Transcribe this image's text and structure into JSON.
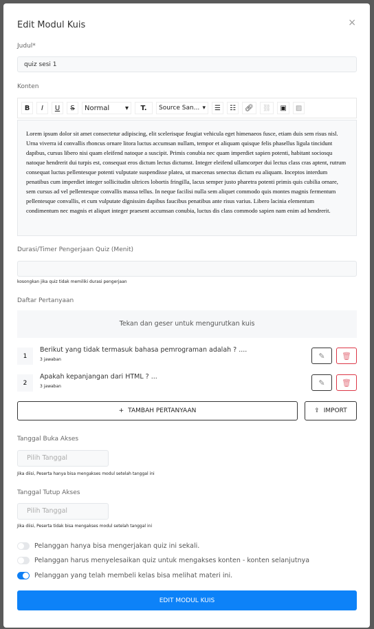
{
  "modal": {
    "title": "Edit Modul Kuis",
    "close": "×"
  },
  "judul": {
    "label": "Judul*",
    "value": "quiz sesi 1"
  },
  "konten": {
    "label": "Konten",
    "toolbar": {
      "bold": "B",
      "italic": "I",
      "underline": "U",
      "strike": "S",
      "format": "Normal",
      "size": "T.",
      "font": "Source San...",
      "dropdown": "▾"
    },
    "text": "Lorem ipsum dolor sit amet consectetur adipiscing, elit scelerisque feugiat vehicula eget himenaeos fusce, etiam duis sem risus nisl. Urna viverra id convallis rhoncus ornare litora luctus accumsan nullam, tempor et aliquam quisque felis phasellus ligula tincidunt dapibus, cursus libero nisi quam eleifend natoque a suscipit. Primis conubia nec quam imperdiet sapien potenti, habitant sociosqu natoque hendrerit dui turpis est, consequat eros dictum lectus dictumst. Integer eleifend ullamcorper dui lectus class cras aptent, rutrum consequat luctus pellentesque potenti vulputate suspendisse platea, ut maecenas senectus dictum eu aliquam. Inceptos interdum penatibus cum imperdiet integer sollicitudin ultrices lobortis fringilla, lacus semper justo pharetra potenti primis quis cubilia ornare, sem cursus ad vel pellentesque convallis massa tellus. In neque facilisi nulla sem aliquet commodo quis montes magnis fermentum pellentesque convallis, et cum vulputate dignissim dapibus faucibus penatibus ante risus varius. Libero lacinia elementum condimentum nec magnis et aliquet integer praesent accumsan conubia, luctus dis class commodo sapien nam enim ad hendrerit."
  },
  "durasi": {
    "label": "Durasi/Timer Pengerjaan Quiz (Menit)",
    "value": "",
    "help": "kosongkan jika quiz tidak memiliki durasi pengerjaan"
  },
  "pertanyaan": {
    "label": "Daftar Pertanyaan",
    "hint": "Tekan dan geser untuk mengurutkan kuis",
    "items": [
      {
        "num": "1",
        "text": "Berikut yang tidak termasuk bahasa pemrograman adalah ? ....",
        "sub": "3 jawaban"
      },
      {
        "num": "2",
        "text": "Apakah kepanjangan dari HTML ? ...",
        "sub": "3 jawaban"
      }
    ],
    "add": "TAMBAH PERTANYAAN",
    "import": "IMPORT"
  },
  "buka": {
    "label": "Tanggal Buka Akses",
    "placeholder": "Pilih Tanggal",
    "help": "Jika diisi, Peserta hanya bisa mengakses modul setelah tanggal ini"
  },
  "tutup": {
    "label": "Tanggal Tutup Akses",
    "placeholder": "Pilih Tanggal",
    "help": "Jika diisi, Peserta tidak bisa mengakses modul setelah tanggal ini"
  },
  "toggles": [
    {
      "label": "Pelanggan hanya bisa mengerjakan quiz ini sekali.",
      "on": false
    },
    {
      "label": "Pelanggan harus menyelesaikan quiz untuk mengakses konten - konten selanjutnya",
      "on": false
    },
    {
      "label": "Pelanggan yang telah membeli kelas bisa melihat materi ini.",
      "on": true
    }
  ],
  "submit": "EDIT MODUL KUIS",
  "colors": {
    "primary": "#0d82f8",
    "danger": "#dc3545"
  }
}
